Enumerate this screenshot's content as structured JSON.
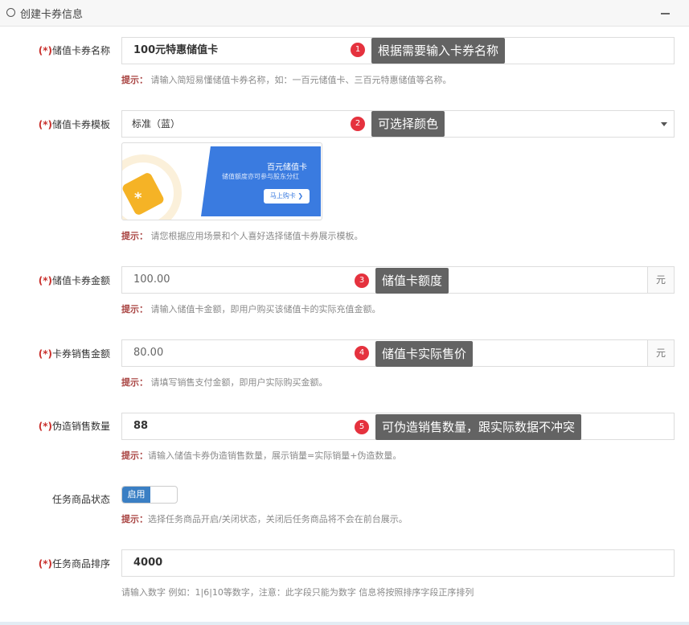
{
  "panel": {
    "title": "创建卡券信息"
  },
  "fields": {
    "name": {
      "required": "(*)",
      "label": "储值卡券名称",
      "value": "100元特惠储值卡",
      "hint_label": "提示：",
      "hint": "请输入简短易懂储值卡券名称，如：一百元储值卡、三百元特惠储值等名称。"
    },
    "template": {
      "required": "(*)",
      "label": "储值卡券模板",
      "value": "标准（蓝）",
      "hint_label": "提示：",
      "hint": "请您根据应用场景和个人喜好选择储值卡券展示模板。",
      "preview": {
        "title": "百元储值卡",
        "subtitle": "储值额度亦可参与股东分红",
        "button": "马上购卡 ❯",
        "coin_mark": "⁎"
      }
    },
    "amount": {
      "required": "(*)",
      "label": "储值卡券金额",
      "value": "100.00",
      "unit": "元",
      "hint_label": "提示：",
      "hint": "请输入储值卡金额，即用户购买该储值卡的实际充值金额。"
    },
    "price": {
      "required": "(*)",
      "label": "卡券销售金额",
      "value": "80.00",
      "unit": "元",
      "hint_label": "提示：",
      "hint": "请填写销售支付金额，即用户实际购买金额。"
    },
    "fake_sales": {
      "required": "(*)",
      "label": "伪造销售数量",
      "value": "88",
      "hint_label": "提示：",
      "hint": "请输入储值卡券伪造销售数量，展示销量=实际销量+伪造数量。"
    },
    "status": {
      "label": "任务商品状态",
      "switch_label": "启用",
      "hint_label": "提示：",
      "hint": "选择任务商品开启/关闭状态，关闭后任务商品将不会在前台展示。"
    },
    "sort": {
      "required": "(*)",
      "label": "任务商品排序",
      "value": "4000",
      "hint": "请输入数字 例如：1|6|10等数字，注意：此字段只能为数字 信息将按照排序字段正序排列"
    }
  },
  "annotations": [
    {
      "num": "1",
      "text": "根据需要输入卡券名称"
    },
    {
      "num": "2",
      "text": "可选择颜色"
    },
    {
      "num": "3",
      "text": "储值卡额度"
    },
    {
      "num": "4",
      "text": "储值卡实际售价"
    },
    {
      "num": "5",
      "text": "可伪造销售数量，跟实际数据不冲突"
    }
  ],
  "colors": {
    "accent": "#3a7be0",
    "required": "#c9302c",
    "badge": "#e5323e",
    "tip_bg": "#636363"
  }
}
